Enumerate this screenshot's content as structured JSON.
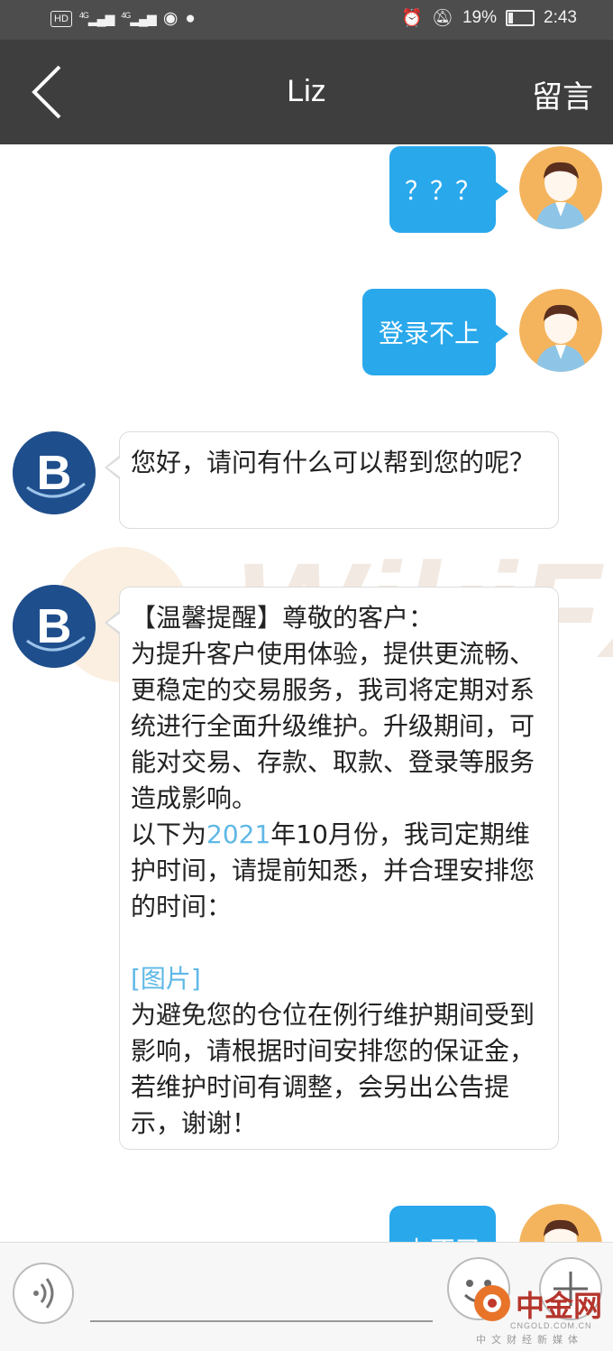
{
  "status_bar": {
    "hd_label": "HD",
    "signal1": "4G",
    "signal2": "4G",
    "battery_percent": "19%",
    "battery_level": 0.19,
    "time": "2:43"
  },
  "nav": {
    "title": "Liz",
    "action_label": "留言"
  },
  "messages": [
    {
      "from": "user",
      "text": "？？？"
    },
    {
      "from": "user",
      "text": "登录不上"
    },
    {
      "from": "agent",
      "text": "您好，请问有什么可以帮到您的呢？"
    },
    {
      "from": "agent",
      "lines": {
        "p1": "【温馨提醒】尊敬的客户：",
        "p2": "为提升客户使用体验，提供更流畅、更稳定的交易服务，我司将定期对系统进行全面升级维护。升级期间，可能对交易、存款、取款、登录等服务造成影响。",
        "p3_pre": "以下为",
        "p3_year": "2021",
        "p3_post": "年10月份，我司定期维护时间，请提前知悉，并合理安排您的时间：",
        "image_link": "[图片]",
        "p4": "为避免您的仓位在例行维护期间受到影响，请根据时间安排您的保证金，若维护时间有调整，会另出公告提示，谢谢！"
      }
    },
    {
      "from": "user",
      "text": "上不了"
    }
  ],
  "agent_avatar_letter": "B",
  "watermark_text": "WikiFX",
  "brand": {
    "name": "中金网",
    "url": "CNGOLD.COM.CN",
    "sub": "中文财经新媒体"
  },
  "colors": {
    "accent": "#29a8ec",
    "navbar": "#3e3e3e",
    "agent_avatar": "#1f4e8c"
  }
}
